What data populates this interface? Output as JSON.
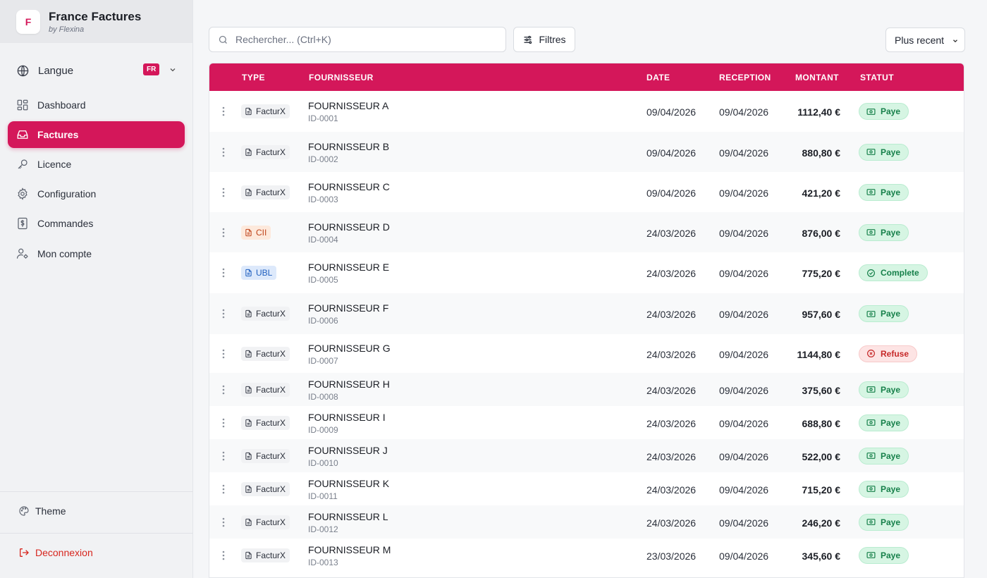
{
  "brand": {
    "logo_letter": "F",
    "title": "France Factures",
    "subtitle": "by Flexina"
  },
  "language": {
    "label": "Langue",
    "code": "FR"
  },
  "nav": [
    {
      "label": "Dashboard",
      "icon": "grid-icon",
      "active": false
    },
    {
      "label": "Factures",
      "icon": "inbox-icon",
      "active": true
    },
    {
      "label": "Licence",
      "icon": "key-icon",
      "active": false
    },
    {
      "label": "Configuration",
      "icon": "gear-icon",
      "active": false
    },
    {
      "label": "Commandes",
      "icon": "dollar-doc-icon",
      "active": false
    },
    {
      "label": "Mon compte",
      "icon": "user-cog-icon",
      "active": false
    }
  ],
  "footer": {
    "theme_label": "Theme",
    "logout_label": "Deconnexion"
  },
  "toolbar": {
    "search_placeholder": "Rechercher... (Ctrl+K)",
    "filter_label": "Filtres",
    "sort_label": "Plus recent"
  },
  "table": {
    "columns": {
      "type": "TYPE",
      "supplier": "FOURNISSEUR",
      "date": "DATE",
      "reception": "RECEPTION",
      "amount": "MONTANT",
      "status": "STATUT"
    },
    "rows": [
      {
        "type": "FacturX",
        "supplier": "FOURNISSEUR A",
        "id": "ID-0001",
        "date": "09/04/2026",
        "reception": "09/04/2026",
        "amount": "1112,40 €",
        "status": "Paye"
      },
      {
        "type": "FacturX",
        "supplier": "FOURNISSEUR B",
        "id": "ID-0002",
        "date": "09/04/2026",
        "reception": "09/04/2026",
        "amount": "880,80 €",
        "status": "Paye"
      },
      {
        "type": "FacturX",
        "supplier": "FOURNISSEUR C",
        "id": "ID-0003",
        "date": "09/04/2026",
        "reception": "09/04/2026",
        "amount": "421,20 €",
        "status": "Paye"
      },
      {
        "type": "CII",
        "supplier": "FOURNISSEUR D",
        "id": "ID-0004",
        "date": "24/03/2026",
        "reception": "09/04/2026",
        "amount": "876,00 €",
        "status": "Paye"
      },
      {
        "type": "UBL",
        "supplier": "FOURNISSEUR E",
        "id": "ID-0005",
        "date": "24/03/2026",
        "reception": "09/04/2026",
        "amount": "775,20 €",
        "status": "Complete"
      },
      {
        "type": "FacturX",
        "supplier": "FOURNISSEUR F",
        "id": "ID-0006",
        "date": "24/03/2026",
        "reception": "09/04/2026",
        "amount": "957,60 €",
        "status": "Paye"
      },
      {
        "type": "FacturX",
        "supplier": "FOURNISSEUR G",
        "id": "ID-0007",
        "date": "24/03/2026",
        "reception": "09/04/2026",
        "amount": "1144,80 €",
        "status": "Refuse"
      },
      {
        "type": "FacturX",
        "supplier": "FOURNISSEUR H",
        "id": "ID-0008",
        "date": "24/03/2026",
        "reception": "09/04/2026",
        "amount": "375,60 €",
        "status": "Paye"
      },
      {
        "type": "FacturX",
        "supplier": "FOURNISSEUR I",
        "id": "ID-0009",
        "date": "24/03/2026",
        "reception": "09/04/2026",
        "amount": "688,80 €",
        "status": "Paye"
      },
      {
        "type": "FacturX",
        "supplier": "FOURNISSEUR J",
        "id": "ID-0010",
        "date": "24/03/2026",
        "reception": "09/04/2026",
        "amount": "522,00 €",
        "status": "Paye"
      },
      {
        "type": "FacturX",
        "supplier": "FOURNISSEUR K",
        "id": "ID-0011",
        "date": "24/03/2026",
        "reception": "09/04/2026",
        "amount": "715,20 €",
        "status": "Paye"
      },
      {
        "type": "FacturX",
        "supplier": "FOURNISSEUR L",
        "id": "ID-0012",
        "date": "24/03/2026",
        "reception": "09/04/2026",
        "amount": "246,20 €",
        "status": "Paye"
      },
      {
        "type": "FacturX",
        "supplier": "FOURNISSEUR M",
        "id": "ID-0013",
        "date": "23/03/2026",
        "reception": "09/04/2026",
        "amount": "345,60 €",
        "status": "Paye"
      }
    ]
  },
  "colors": {
    "accent": "#d4175a",
    "paid": "#16804a",
    "refused": "#c62828",
    "logout": "#d7261e"
  }
}
